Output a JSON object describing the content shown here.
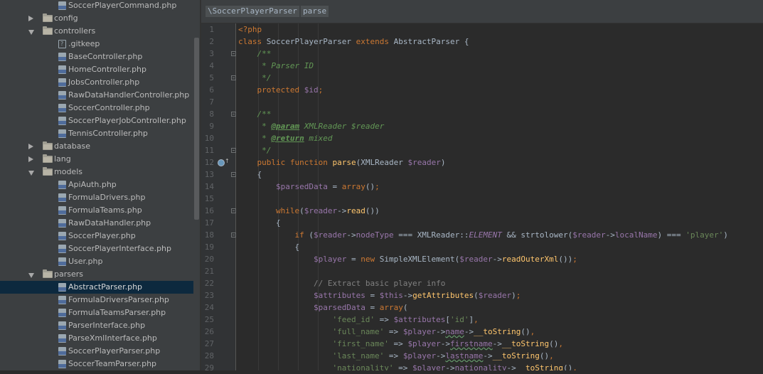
{
  "project_tree": {
    "rows": [
      {
        "label": "SoccerPlayerCommand.php",
        "kind": "php",
        "indent": 2
      },
      {
        "label": "config",
        "kind": "folder",
        "state": "collapsed",
        "indent": 1
      },
      {
        "label": "controllers",
        "kind": "folder",
        "state": "expanded",
        "indent": 1
      },
      {
        "label": ".gitkeep",
        "kind": "text",
        "indent": 2
      },
      {
        "label": "BaseController.php",
        "kind": "php",
        "indent": 2
      },
      {
        "label": "HomeController.php",
        "kind": "php",
        "indent": 2
      },
      {
        "label": "JobsController.php",
        "kind": "php",
        "indent": 2
      },
      {
        "label": "RawDataHandlerController.php",
        "kind": "php",
        "indent": 2
      },
      {
        "label": "SoccerController.php",
        "kind": "php",
        "indent": 2
      },
      {
        "label": "SoccerPlayerJobController.php",
        "kind": "php",
        "indent": 2
      },
      {
        "label": "TennisController.php",
        "kind": "php",
        "indent": 2
      },
      {
        "label": "database",
        "kind": "folder",
        "state": "collapsed",
        "indent": 1
      },
      {
        "label": "lang",
        "kind": "folder",
        "state": "collapsed",
        "indent": 1
      },
      {
        "label": "models",
        "kind": "folder",
        "state": "expanded",
        "indent": 1
      },
      {
        "label": "ApiAuth.php",
        "kind": "php",
        "indent": 2
      },
      {
        "label": "FormulaDrivers.php",
        "kind": "php",
        "indent": 2
      },
      {
        "label": "FormulaTeams.php",
        "kind": "php",
        "indent": 2
      },
      {
        "label": "RawDataHandler.php",
        "kind": "php",
        "indent": 2
      },
      {
        "label": "SoccerPlayer.php",
        "kind": "php",
        "indent": 2
      },
      {
        "label": "SoccerPlayerInterface.php",
        "kind": "php",
        "indent": 2
      },
      {
        "label": "User.php",
        "kind": "php",
        "indent": 2
      },
      {
        "label": "parsers",
        "kind": "folder",
        "state": "expanded",
        "indent": 1
      },
      {
        "label": "AbstractParser.php",
        "kind": "php",
        "indent": 2,
        "selected": true
      },
      {
        "label": "FormulaDriversParser.php",
        "kind": "php",
        "indent": 2
      },
      {
        "label": "FormulaTeamsParser.php",
        "kind": "php",
        "indent": 2
      },
      {
        "label": "ParserInterface.php",
        "kind": "php",
        "indent": 2
      },
      {
        "label": "ParseXmlInterface.php",
        "kind": "php",
        "indent": 2
      },
      {
        "label": "SoccerPlayerParser.php",
        "kind": "php",
        "indent": 2
      },
      {
        "label": "SoccerTeamParser.php",
        "kind": "php",
        "indent": 2
      }
    ]
  },
  "breadcrumb": {
    "items": [
      "\\SoccerPlayerParser",
      "parse"
    ]
  },
  "editor": {
    "lines": [
      {
        "n": "1",
        "segs": [
          [
            "kw",
            "<?php"
          ]
        ]
      },
      {
        "n": "2",
        "segs": [
          [
            "kw",
            "class "
          ],
          [
            "",
            "SoccerPlayerParser "
          ],
          [
            "kw",
            "extends "
          ],
          [
            "",
            "AbstractParser {"
          ]
        ]
      },
      {
        "n": "3",
        "segs": [
          [
            "",
            "    "
          ],
          [
            "doc",
            "/**"
          ]
        ]
      },
      {
        "n": "4",
        "segs": [
          [
            "",
            "    "
          ],
          [
            "doc",
            " * Parser ID"
          ]
        ]
      },
      {
        "n": "5",
        "segs": [
          [
            "",
            "    "
          ],
          [
            "doc",
            " */"
          ]
        ]
      },
      {
        "n": "6",
        "segs": [
          [
            "",
            "    "
          ],
          [
            "kw",
            "protected "
          ],
          [
            "var",
            "$id"
          ],
          [
            "kw",
            ";"
          ]
        ]
      },
      {
        "n": "7",
        "segs": []
      },
      {
        "n": "8",
        "segs": [
          [
            "",
            "    "
          ],
          [
            "doc",
            "/**"
          ]
        ]
      },
      {
        "n": "9",
        "segs": [
          [
            "",
            "    "
          ],
          [
            "doc",
            " * "
          ],
          [
            "doctag",
            "@param"
          ],
          [
            "doc",
            " XMLReader "
          ],
          [
            "doc",
            "$reader"
          ]
        ]
      },
      {
        "n": "10",
        "segs": [
          [
            "",
            "    "
          ],
          [
            "doc",
            " * "
          ],
          [
            "doctag",
            "@return"
          ],
          [
            "doc",
            " mixed"
          ]
        ]
      },
      {
        "n": "11",
        "segs": [
          [
            "",
            "    "
          ],
          [
            "doc",
            " */"
          ]
        ]
      },
      {
        "n": "12",
        "segs": [
          [
            "",
            "    "
          ],
          [
            "kw",
            "public function "
          ],
          [
            "fn",
            "parse"
          ],
          [
            "",
            "(XMLReader "
          ],
          [
            "var",
            "$reader"
          ],
          [
            "",
            ")"
          ]
        ]
      },
      {
        "n": "13",
        "segs": [
          [
            "",
            "    {"
          ]
        ]
      },
      {
        "n": "14",
        "segs": [
          [
            "",
            "        "
          ],
          [
            "var",
            "$parsedData"
          ],
          [
            "",
            " = "
          ],
          [
            "kw",
            "array"
          ],
          [
            "",
            "()"
          ],
          [
            "kw",
            ";"
          ]
        ]
      },
      {
        "n": "15",
        "segs": []
      },
      {
        "n": "16",
        "segs": [
          [
            "",
            "        "
          ],
          [
            "kw",
            "while"
          ],
          [
            "",
            "("
          ],
          [
            "var",
            "$reader"
          ],
          [
            "",
            "->"
          ],
          [
            "fn",
            "read"
          ],
          [
            "",
            "())"
          ]
        ]
      },
      {
        "n": "17",
        "segs": [
          [
            "",
            "        {"
          ]
        ]
      },
      {
        "n": "18",
        "segs": [
          [
            "",
            "            "
          ],
          [
            "kw",
            "if "
          ],
          [
            "",
            "("
          ],
          [
            "var",
            "$reader"
          ],
          [
            "",
            "->"
          ],
          [
            "var",
            "nodeType"
          ],
          [
            "",
            " === XMLReader::"
          ],
          [
            "const",
            "ELEMENT"
          ],
          [
            "",
            " && strtolower("
          ],
          [
            "var",
            "$reader"
          ],
          [
            "",
            "->"
          ],
          [
            "var",
            "localName"
          ],
          [
            "",
            ") === "
          ],
          [
            "str",
            "'player'"
          ],
          [
            "",
            ")"
          ]
        ]
      },
      {
        "n": "19",
        "segs": [
          [
            "",
            "            {"
          ]
        ]
      },
      {
        "n": "20",
        "segs": [
          [
            "",
            "                "
          ],
          [
            "var",
            "$player"
          ],
          [
            "",
            " = "
          ],
          [
            "kw",
            "new "
          ],
          [
            "",
            "SimpleXMLElement("
          ],
          [
            "var",
            "$reader"
          ],
          [
            "",
            "->"
          ],
          [
            "fn",
            "readOuterXml"
          ],
          [
            "",
            "())"
          ],
          [
            "kw",
            ";"
          ]
        ]
      },
      {
        "n": "21",
        "segs": []
      },
      {
        "n": "22",
        "segs": [
          [
            "",
            "                "
          ],
          [
            "cmt",
            "// Extract basic player info"
          ]
        ]
      },
      {
        "n": "23",
        "segs": [
          [
            "",
            "                "
          ],
          [
            "var",
            "$attributes"
          ],
          [
            "",
            " = "
          ],
          [
            "var",
            "$this"
          ],
          [
            "",
            "->"
          ],
          [
            "fn",
            "getAttributes"
          ],
          [
            "",
            "("
          ],
          [
            "var",
            "$reader"
          ],
          [
            "",
            ")"
          ],
          [
            "kw",
            ";"
          ]
        ]
      },
      {
        "n": "24",
        "segs": [
          [
            "",
            "                "
          ],
          [
            "var",
            "$parsedData"
          ],
          [
            "",
            " = "
          ],
          [
            "kw",
            "array"
          ],
          [
            "",
            "("
          ]
        ]
      },
      {
        "n": "25",
        "segs": [
          [
            "",
            "                    "
          ],
          [
            "str",
            "'feed_id'"
          ],
          [
            "",
            " => "
          ],
          [
            "var",
            "$attributes"
          ],
          [
            "",
            "["
          ],
          [
            "str",
            "'id'"
          ],
          [
            "",
            "]"
          ],
          [
            "kw",
            ","
          ]
        ]
      },
      {
        "n": "26",
        "segs": [
          [
            "",
            "                    "
          ],
          [
            "str",
            "'full_name'"
          ],
          [
            "",
            " => "
          ],
          [
            "var",
            "$player"
          ],
          [
            "",
            "->"
          ],
          [
            "varw",
            "name"
          ],
          [
            "",
            "->"
          ],
          [
            "fn",
            "__toString"
          ],
          [
            "",
            "()"
          ],
          [
            "kw",
            ","
          ]
        ]
      },
      {
        "n": "27",
        "segs": [
          [
            "",
            "                    "
          ],
          [
            "str",
            "'first_name'"
          ],
          [
            "",
            " => "
          ],
          [
            "var",
            "$player"
          ],
          [
            "",
            "->"
          ],
          [
            "varw",
            "firstname"
          ],
          [
            "",
            "->"
          ],
          [
            "fn",
            "__toString"
          ],
          [
            "",
            "()"
          ],
          [
            "kw",
            ","
          ]
        ]
      },
      {
        "n": "28",
        "segs": [
          [
            "",
            "                    "
          ],
          [
            "str",
            "'last_name'"
          ],
          [
            "",
            " => "
          ],
          [
            "var",
            "$player"
          ],
          [
            "",
            "->"
          ],
          [
            "varw",
            "lastname"
          ],
          [
            "",
            "->"
          ],
          [
            "fn",
            "__toString"
          ],
          [
            "",
            "()"
          ],
          [
            "kw",
            ","
          ]
        ]
      },
      {
        "n": "29",
        "segs": [
          [
            "",
            "                    "
          ],
          [
            "str",
            "'nationality'"
          ],
          [
            "",
            " => "
          ],
          [
            "var",
            "$player"
          ],
          [
            "",
            "->"
          ],
          [
            "varw",
            "nationality"
          ],
          [
            "",
            "->"
          ],
          [
            "fn",
            "__toString"
          ],
          [
            "",
            "()"
          ],
          [
            "kw",
            ","
          ]
        ]
      }
    ]
  },
  "colors": {
    "tree_bg": "#3c3f41",
    "editor_bg": "#2b2b2b",
    "gutter_bg": "#313335",
    "selection": "#0d293e",
    "keyword": "#cc7832",
    "function": "#ffc66d",
    "variable": "#9876aa",
    "string": "#6a8759",
    "doc_comment": "#629755"
  }
}
